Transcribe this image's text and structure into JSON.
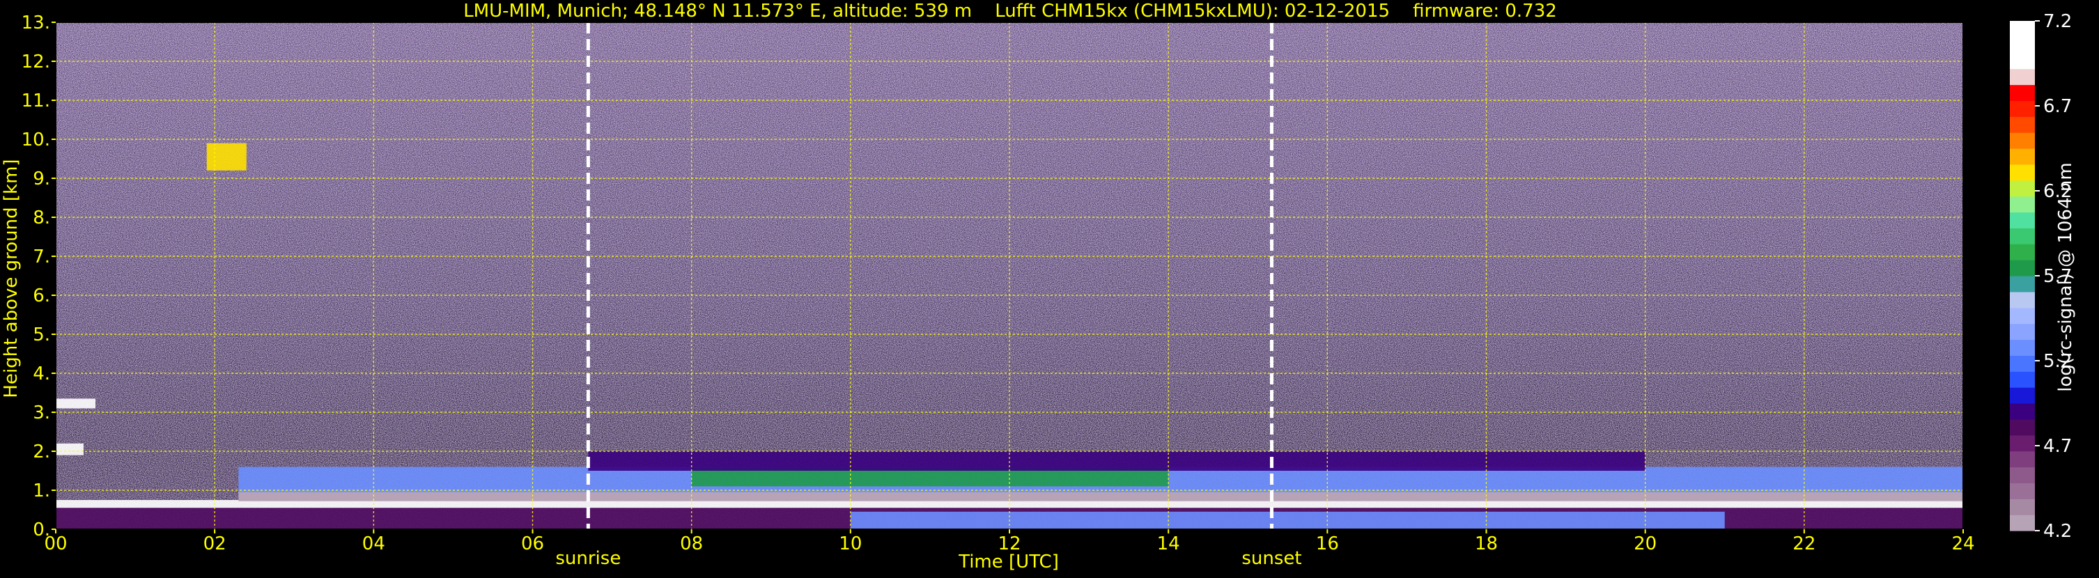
{
  "title": "LMU-MIM, Munich; 48.148° N 11.573° E, altitude: 539 m    Lufft CHM15kx (CHM15kxLMU): 02-12-2015    firmware: 0.732",
  "colors": {
    "text": "#ffff00",
    "background": "#000000",
    "grid": "#ffff00",
    "marker_line": "#ffffff",
    "colorbar_label": "#ffffff"
  },
  "chart_data": {
    "type": "heatmap",
    "xlabel": "Time [UTC]",
    "ylabel": "Height above ground [km]",
    "xlim": [
      0,
      24
    ],
    "ylim": [
      0,
      13
    ],
    "x_ticks": [
      "00",
      "02",
      "04",
      "06",
      "08",
      "10",
      "12",
      "14",
      "16",
      "18",
      "20",
      "22",
      "24"
    ],
    "y_ticks": [
      "0.",
      "1.",
      "2.",
      "3.",
      "4.",
      "5.",
      "6.",
      "7.",
      "8.",
      "9.",
      "10.",
      "11.",
      "12.",
      "13."
    ],
    "grid": true,
    "markers": [
      {
        "label": "sunrise",
        "time": 6.7
      },
      {
        "label": "sunset",
        "time": 15.3
      }
    ],
    "layers": [
      {
        "feature": "surface purple aerosol",
        "t0": 0,
        "t1": 24,
        "h0": 0.0,
        "h1": 0.55,
        "value": 4.8
      },
      {
        "feature": "near-surface blue aerosol (afternoon)",
        "t0": 10,
        "t1": 21,
        "h0": 0.0,
        "h1": 0.45,
        "value": 5.3
      },
      {
        "feature": "white mixed-layer top",
        "t0": 0,
        "t1": 24,
        "h0": 0.55,
        "h1": 0.75,
        "value": 7.1
      },
      {
        "feature": "black cloud-attenuated band",
        "t0": 2.3,
        "t1": 24,
        "h0": 0.72,
        "h1": 1.0,
        "value": 4.2
      },
      {
        "feature": "blue residual layer",
        "t0": 2.3,
        "t1": 24,
        "h0": 0.95,
        "h1": 1.6,
        "value": 5.25
      },
      {
        "feature": "green elevated layer",
        "t0": 8,
        "t1": 14,
        "h0": 1.1,
        "h1": 1.6,
        "value": 5.75
      },
      {
        "feature": "upper pink haze",
        "t0": 6.7,
        "t1": 20,
        "h0": 1.5,
        "h1": 2.0,
        "value": 4.9
      },
      {
        "feature": "cirrus cloud",
        "t0": 1.9,
        "t1": 2.4,
        "h0": 9.2,
        "h1": 9.9,
        "value": 6.3
      },
      {
        "feature": "cloud at 3.2 km",
        "t0": 0,
        "t1": 0.5,
        "h0": 3.1,
        "h1": 3.35,
        "value": 7.0
      },
      {
        "feature": "cloud at 2 km",
        "t0": 0,
        "t1": 0.35,
        "h0": 1.9,
        "h1": 2.2,
        "value": 7.0
      }
    ],
    "colorbar": {
      "label": "log(rc-signal) @ 1064 nm",
      "min": 4.2,
      "max": 7.2,
      "ticks": [
        "4.2",
        "4.7",
        "5.2",
        "5.7",
        "6.2",
        "6.7",
        "7.2"
      ],
      "colors": [
        "#b7a3b6",
        "#a68aa4",
        "#9a6f98",
        "#8d5a8b",
        "#7f3f7f",
        "#6a1d6f",
        "#500b60",
        "#3a0080",
        "#1818d8",
        "#2a52ff",
        "#4a75ff",
        "#6b8fff",
        "#8aa4ff",
        "#a4b8ff",
        "#b8c8f0",
        "#3aa0a0",
        "#1f9a4a",
        "#2fb04a",
        "#3ac870",
        "#50e0a0",
        "#90f090",
        "#c0f040",
        "#ffe000",
        "#ffb000",
        "#ff8000",
        "#ff4a00",
        "#ff2000",
        "#ff0000",
        "#f0d0d0",
        "#ffffff",
        "#ffffff",
        "#ffffff"
      ]
    }
  }
}
